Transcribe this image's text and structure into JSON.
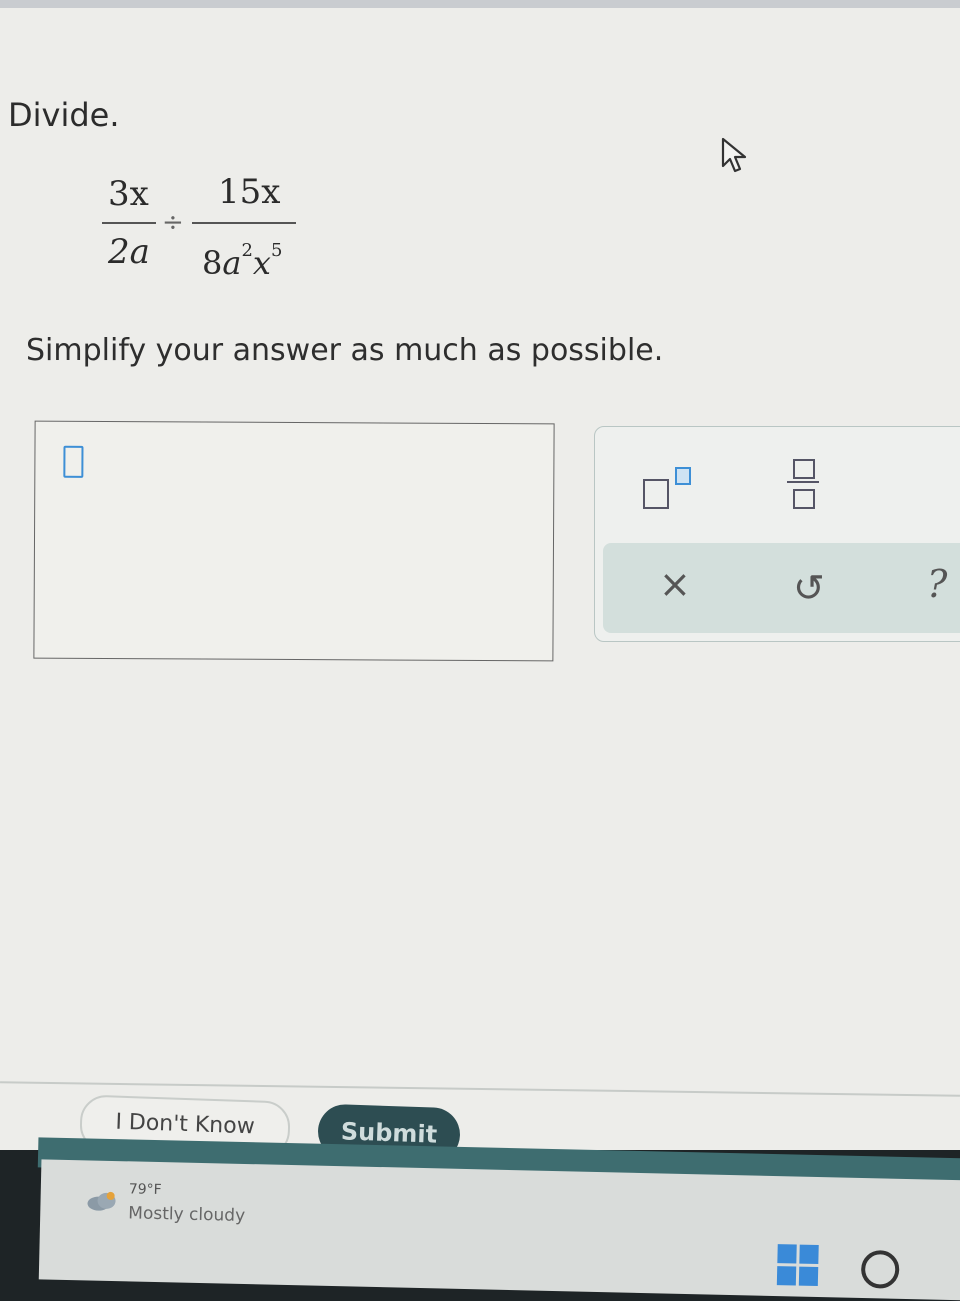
{
  "question": {
    "prompt": "Divide.",
    "fraction_1": {
      "numerator": "3x",
      "denominator": "2a"
    },
    "operator": "÷",
    "fraction_2": {
      "numerator": "15x",
      "denominator": {
        "coefficient": "8",
        "var_a": "a",
        "exp_a": "2",
        "var_x": "x",
        "exp_x": "5"
      }
    },
    "instruction": "Simplify your answer as much as possible."
  },
  "answer": {
    "value": ""
  },
  "palette": {
    "buttons": [
      "superscript-icon",
      "fraction-icon",
      "clear-icon",
      "undo-icon",
      "help-icon"
    ],
    "clear_symbol": "×",
    "undo_symbol": "↺",
    "help_symbol": "?"
  },
  "actions": {
    "dont_know_label": "I Don't Know",
    "submit_label": "Submit"
  },
  "taskbar": {
    "weather_temp": "79°F",
    "weather_desc": "Mostly cloudy"
  },
  "colors": {
    "accent": "#3d8fd6",
    "submit_bg": "#2d4d52",
    "palette_row_bg": "#d3dfdc"
  }
}
